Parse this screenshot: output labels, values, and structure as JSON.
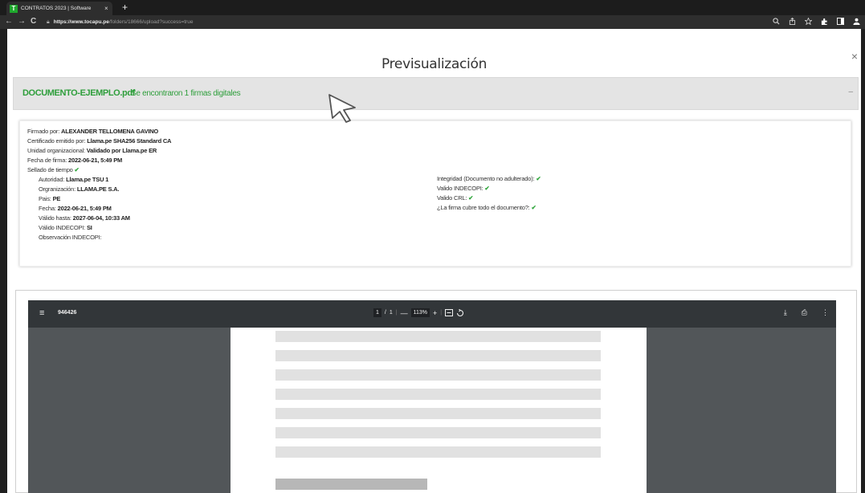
{
  "browser": {
    "tab_favicon": "T",
    "tab_title": "CONTRATOS 2023 | Software",
    "tab_close": "×",
    "new_tab": "+",
    "back": "←",
    "forward": "→",
    "reload": "C",
    "url_host": "https://www.tocapu.pe",
    "url_path": "/folders/18666/upload?success=true"
  },
  "modal": {
    "title": "Previsualización",
    "close": "×"
  },
  "document": {
    "name": "DOCUMENTO-EJEMPLO.pdf",
    "signatures_text": "Se encontraron 1 firmas digitales",
    "collapse": "–"
  },
  "signature": {
    "signed_by_label": "Firmado por:",
    "signed_by": "ALEXANDER TELLOMENA GAVINO",
    "cert_label": "Certificado emitido por:",
    "cert": "Llama.pe SHA256 Standard CA",
    "unit_label": "Unidad organizacional:",
    "unit": "Validado por Llama.pe ER",
    "date_label": "Fecha de firma:",
    "date": "2022-06-21, 5:49 PM",
    "timestamp_label": "Sellado de tiempo",
    "authority_label": "Autoridad:",
    "authority": "Llama.pe TSU 1",
    "org_label": "Orgranización:",
    "org": "LLAMA.PE S.A.",
    "country_label": "Pais:",
    "country": "PE",
    "ts_date_label": "Fecha:",
    "ts_date": "2022-06-21, 5:49 PM",
    "valid_until_label": "Válido hasta:",
    "valid_until": "2027-06-04, 10:33 AM",
    "valid_indecopi_label": "Válido INDECOPI:",
    "valid_indecopi": "SI",
    "observation_label": "Observación INDECOPI:",
    "integrity_label": "Integridad (Documento no adulterado):",
    "valid_indecopi_right_label": "Valido INDECOPI:",
    "valid_crl_label": "Valido CRL:",
    "covers_doc_label": "¿La firma cubre todo el documento?:",
    "check": "✔"
  },
  "viewer": {
    "menu_icon": "≡",
    "file_name": "946426",
    "page_current": "1",
    "page_sep": "/",
    "page_total": "1",
    "zoom_out": "—",
    "zoom": "113%",
    "zoom_in": "+",
    "download": "⤓",
    "print": "⎙",
    "more": "⋮"
  },
  "colors": {
    "accent_green": "#2e9e3b",
    "viewer_bg": "#525659",
    "viewer_bar": "#323639"
  }
}
